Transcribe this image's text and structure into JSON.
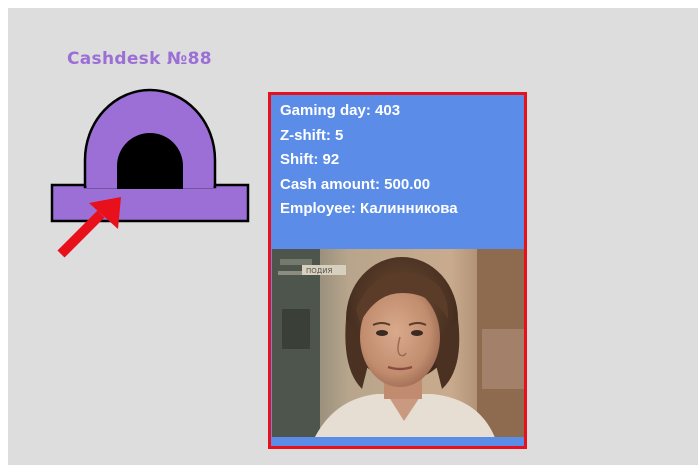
{
  "cashdesk": {
    "title": "Cashdesk №88",
    "icon": "cashdesk-arch-icon",
    "color": "#9b6fd6"
  },
  "pointer": {
    "icon": "red-arrow-icon",
    "color": "#e8101a"
  },
  "popup": {
    "border_color": "#e8101a",
    "background": "#5b8de8",
    "lines": [
      {
        "label": "Gaming day: 403"
      },
      {
        "label": "Z-shift: 5"
      },
      {
        "label": "Shift: 92"
      },
      {
        "label": "Cash amount: 500.00"
      },
      {
        "label": "Employee: Калинникова"
      }
    ],
    "video": {
      "icon": "employee-camera-snapshot",
      "caption": "ПОДИЯ"
    }
  }
}
